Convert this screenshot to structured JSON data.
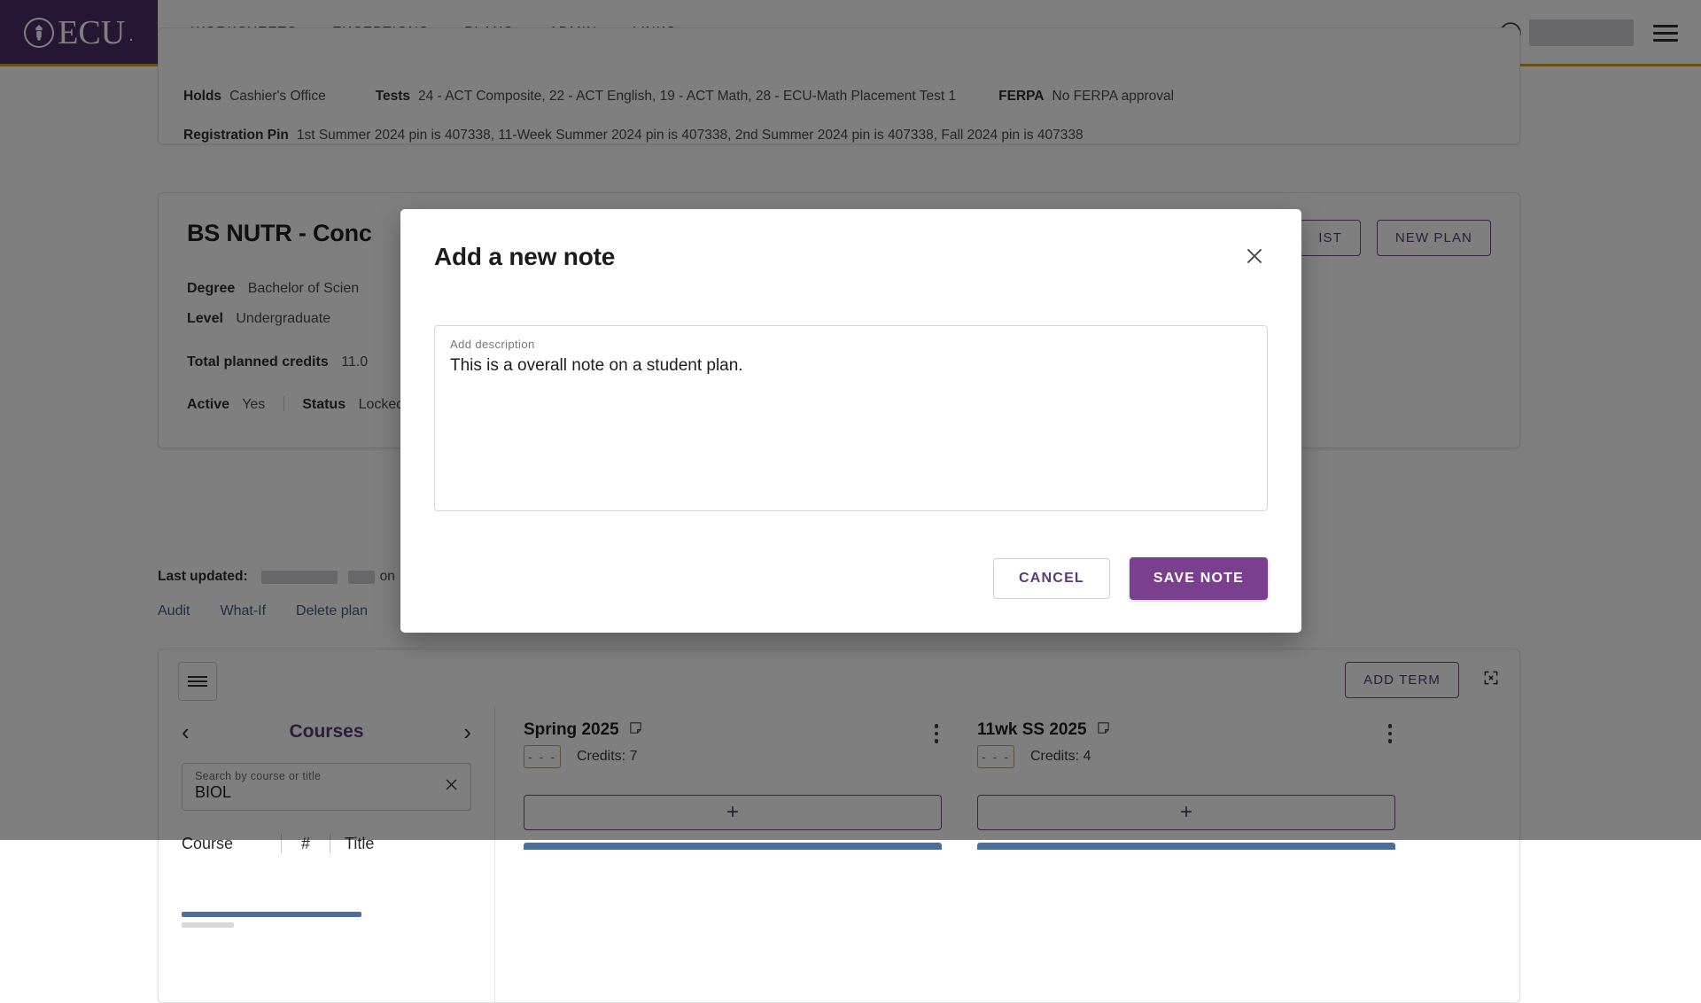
{
  "colors": {
    "brand_purple": "#4b2e66",
    "accent_gold": "#c9a227",
    "button_purple": "#7b3f8f",
    "link_blue": "#3f5d8a",
    "course_bar_blue": "#4a6f9b"
  },
  "nav": {
    "brand": "ECU",
    "brand_dot": ".",
    "links": [
      {
        "label": "WORKSHEETS"
      },
      {
        "label": "EXCEPTIONS"
      },
      {
        "label": "PLANS"
      },
      {
        "label": "ADMIN"
      },
      {
        "label": "LINKS"
      }
    ],
    "avatar_icon": "user-circle-icon",
    "menu_icon": "hamburger-icon"
  },
  "student_info": {
    "holds_label": "Holds",
    "holds_value": "Cashier's Office",
    "tests_label": "Tests",
    "tests_value": "24 - ACT Composite, 22 - ACT English, 19 - ACT Math, 28 - ECU-Math Placement Test 1",
    "ferpa_label": "FERPA",
    "ferpa_value": "No FERPA approval",
    "pin_label": "Registration Pin",
    "pin_value": "1st Summer 2024 pin is 407338, 11-Week Summer 2024 pin is 407338, 2nd Summer 2024 pin is 407338, Fall 2024 pin is 407338"
  },
  "plan": {
    "title": "BS NUTR - Conc",
    "actions": [
      {
        "label": "IST",
        "name": "audit-checklist-button"
      },
      {
        "label": "NEW PLAN",
        "name": "new-plan-button"
      }
    ],
    "degree_label": "Degree",
    "degree_value": "Bachelor of Scien",
    "level_label": "Level",
    "level_value": "Undergraduate",
    "credits_label": "Total planned credits",
    "credits_value": "11.0",
    "active_label": "Active",
    "active_value": "Yes",
    "status_label": "Status",
    "status_value": "Locked",
    "last_updated_label": "Last updated:",
    "last_updated_by": "on",
    "links": [
      {
        "label": "Audit"
      },
      {
        "label": "What-If"
      },
      {
        "label": "Delete plan"
      }
    ]
  },
  "planner": {
    "menu_icon": "hamburger-icon",
    "add_term_label": "ADD TERM",
    "expand_icon": "expand-icon",
    "courses_pane": {
      "prev_icon": "chevron-left-icon",
      "title": "Courses",
      "next_icon": "chevron-right-icon",
      "search_label": "Search by course or title",
      "search_value": "BIOL",
      "clear_icon": "close-icon",
      "columns": [
        "Course",
        "#",
        "Title"
      ]
    },
    "terms": [
      {
        "name": "Spring 2025",
        "note_icon": "note-icon",
        "grade": "- - -",
        "credits_label": "Credits:",
        "credits_value": "7",
        "add_icon": "plus-icon",
        "kebab_icon": "more-vertical-icon"
      },
      {
        "name": "11wk SS 2025",
        "note_icon": "note-icon",
        "grade": "- - -",
        "credits_label": "Credits:",
        "credits_value": "4",
        "add_icon": "plus-icon",
        "kebab_icon": "more-vertical-icon"
      }
    ]
  },
  "modal": {
    "title": "Add a new note",
    "close_icon": "close-icon",
    "description_label": "Add description",
    "description_value": "This is a overall note on a student plan.",
    "cancel_label": "CANCEL",
    "save_label": "SAVE NOTE"
  }
}
